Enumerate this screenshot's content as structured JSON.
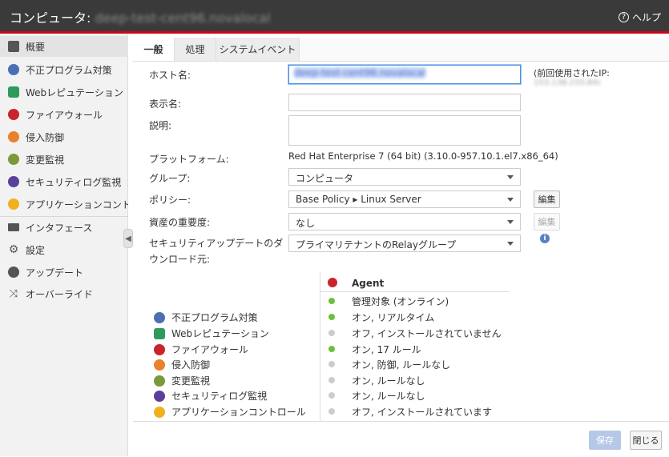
{
  "title": {
    "prefix": "コンピュータ: ",
    "host": "deep-test-cent96.novalocal"
  },
  "help": {
    "label": "ヘルプ",
    "icon": "?"
  },
  "sidebar": {
    "items": [
      {
        "label": "概要",
        "icon": "summary-icon",
        "color": "#555555"
      },
      {
        "label": "不正プログラム対策",
        "icon": "anti-malware-icon",
        "color": "#4a6fb5"
      },
      {
        "label": "Webレピュテーション",
        "icon": "web-reputation-icon",
        "color": "#2e9a5c"
      },
      {
        "label": "ファイアウォール",
        "icon": "firewall-icon",
        "color": "#c9242b"
      },
      {
        "label": "侵入防御",
        "icon": "intrusion-prevention-icon",
        "color": "#e8822a"
      },
      {
        "label": "変更監視",
        "icon": "integrity-monitoring-icon",
        "color": "#7a9a3a"
      },
      {
        "label": "セキュリティログ監視",
        "icon": "log-inspection-icon",
        "color": "#5a3f9a"
      },
      {
        "label": "アプリケーションコントロール",
        "icon": "application-control-icon",
        "color": "#f0b020"
      },
      {
        "label": "インタフェース",
        "icon": "interfaces-icon",
        "color": "#555555"
      },
      {
        "label": "設定",
        "icon": "settings-icon",
        "color": "#555555"
      },
      {
        "label": "アップデート",
        "icon": "updates-icon",
        "color": "#555555"
      },
      {
        "label": "オーバーライド",
        "icon": "overrides-icon",
        "color": "#555555"
      }
    ]
  },
  "tabs": [
    "一般",
    "処理",
    "システムイベント"
  ],
  "form": {
    "hostname_label": "ホスト名:",
    "hostname_value": "deep-test-cent96.novalocal",
    "prev_ip_label": "(前回使用されたIP:",
    "prev_ip_value": "153.138.233.84)",
    "display_name_label": "表示名:",
    "display_name_value": "",
    "description_label": "説明:",
    "description_value": "",
    "platform_label": "プラットフォーム:",
    "platform_value": "Red Hat Enterprise 7 (64 bit) (3.10.0-957.10.1.el7.x86_64)",
    "group_label": "グループ:",
    "group_value": "コンピュータ",
    "policy_label": "ポリシー:",
    "policy_value": "Base Policy ▸ Linux Server",
    "policy_edit": "編集",
    "asset_label": "資産の重要度:",
    "asset_value": "なし",
    "asset_edit": "編集",
    "download_label": "セキュリティアップデートのダウンロード元:",
    "download_value": "プライマリテナントのRelayグループ"
  },
  "modules": {
    "header": "Agent",
    "agent_status": {
      "status": "管理対象 (オンライン)",
      "dot": "#6cbf3a"
    },
    "rows": [
      {
        "name": "不正プログラム対策",
        "icon": "anti-malware-icon",
        "color": "#4a6fb5",
        "status": "オン, リアルタイム",
        "dot": "#6cbf3a"
      },
      {
        "name": "Webレピュテーション",
        "icon": "web-reputation-icon",
        "color": "#2e9a5c",
        "status": "オフ, インストールされていません",
        "dot": "#cccccc"
      },
      {
        "name": "ファイアウォール",
        "icon": "firewall-icon",
        "color": "#c9242b",
        "status": "オン, 17 ルール",
        "dot": "#6cbf3a"
      },
      {
        "name": "侵入防御",
        "icon": "intrusion-prevention-icon",
        "color": "#e8822a",
        "status": "オン, 防御, ルールなし",
        "dot": "#cccccc"
      },
      {
        "name": "変更監視",
        "icon": "integrity-monitoring-icon",
        "color": "#7a9a3a",
        "status": "オン, ルールなし",
        "dot": "#cccccc"
      },
      {
        "name": "セキュリティログ監視",
        "icon": "log-inspection-icon",
        "color": "#5a3f9a",
        "status": "オン, ルールなし",
        "dot": "#cccccc"
      },
      {
        "name": "アプリケーションコントロール",
        "icon": "application-control-icon",
        "color": "#f0b020",
        "status": "オフ, インストールされています",
        "dot": "#cccccc"
      }
    ]
  },
  "footer": {
    "save": "保存",
    "close": "閉じる"
  }
}
